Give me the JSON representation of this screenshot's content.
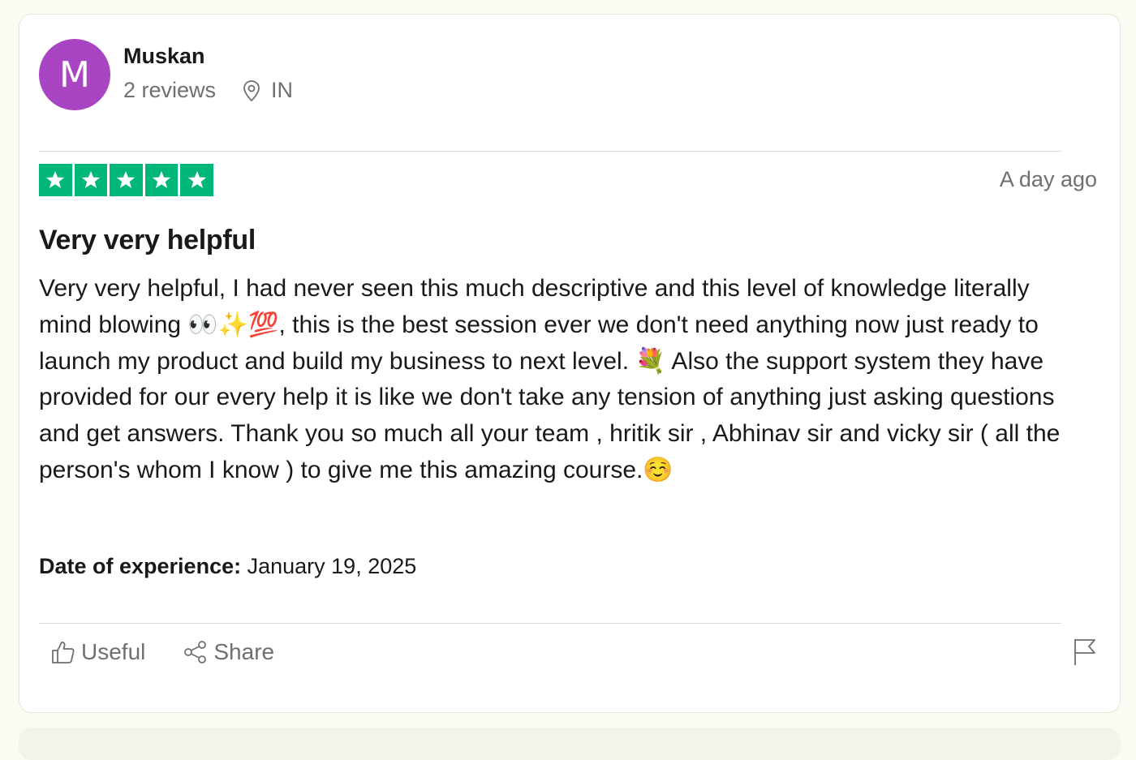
{
  "reviewer": {
    "initial": "M",
    "name": "Muskan",
    "reviews": "2 reviews",
    "country": "IN",
    "avatar_color": "#a944c2"
  },
  "review": {
    "rating": 5,
    "max_rating": 5,
    "star_color": "#00b67a",
    "posted": "A day ago",
    "title": "Very very helpful",
    "text": "Very very helpful, I had never seen this much descriptive and this level of knowledge literally mind blowing 👀✨💯, this is the best session ever we don't need anything now just ready to launch my product and build my business to next level. 💐 Also the support system they have provided for our every help it is like we don't take any tension of anything just asking questions and get answers. Thank you so much all your team , hritik sir , Abhinav sir and vicky sir ( all the person's whom I know ) to give me this amazing course.☺️",
    "date_label": "Date of experience:",
    "date_value": "January 19, 2025"
  },
  "actions": {
    "useful": "Useful",
    "share": "Share"
  },
  "icons": {
    "location": "location-pin-icon",
    "useful": "thumbs-up-icon",
    "share": "share-icon",
    "report": "flag-icon"
  }
}
